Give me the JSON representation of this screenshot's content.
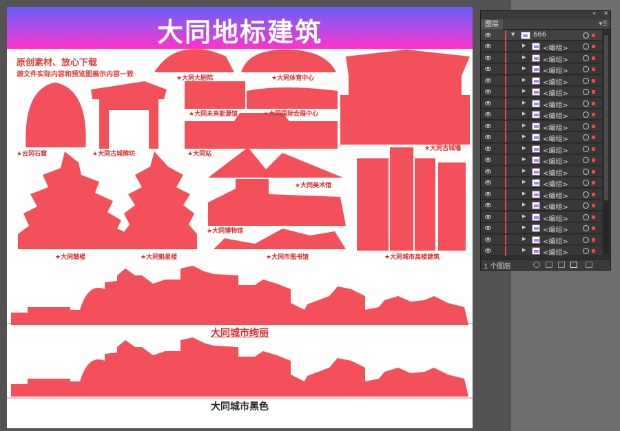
{
  "artboard": {
    "title": "大同地标建筑",
    "promo_line1": "原创素材、放心下载",
    "promo_line2": "源文件实际内容和预览图展示内容一致",
    "landmarks": [
      "★大同大剧院",
      "★大同体育中心",
      "★大同古城墙",
      "★大同未来能源馆",
      "★大同国际会展中心",
      "★云冈石窟",
      "★大同古城牌坊",
      "★大同站",
      "★大同美术馆",
      "★大同博物馆",
      "★大同鼓楼",
      "★大同魁星楼",
      "★大同市图书馆",
      "★大同城市高楼建筑"
    ],
    "caption_colorful": "大同城市绚丽",
    "caption_black": "大同城市黑色",
    "art_color": "#f4505a",
    "banner_colors": [
      "#6a5cf5",
      "#ff33cc"
    ]
  },
  "layers_panel": {
    "tab_label": "图层",
    "top_layer_name": "666",
    "group_name": "<编组>",
    "group_count_visible": 19,
    "footer_count": "1 个图层",
    "layer_color": "#e84a4a",
    "collapse_icon": "double-chevron-icon",
    "close_icon": "close-icon",
    "menu_icon": "panel-menu-icon"
  }
}
